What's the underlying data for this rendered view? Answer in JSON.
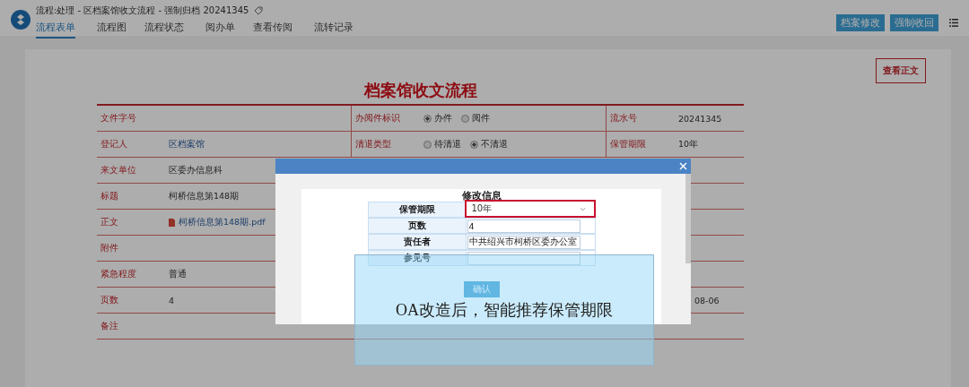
{
  "header": {
    "title": "流程:处理 - 区档案馆收文流程 - 强制归档 20241345",
    "tabs": [
      {
        "label": "流程表单",
        "selected": true
      },
      {
        "label": "流程图",
        "selected": false
      },
      {
        "label": "流程状态",
        "selected": false
      },
      {
        "label": "阅办单",
        "selected": false
      },
      {
        "label": "查看传阅",
        "selected": false
      },
      {
        "label": "流转记录",
        "selected": false
      }
    ],
    "buttons": [
      "档案修改",
      "强制收回"
    ]
  },
  "form": {
    "view_button": "查看正文",
    "title": "档案馆收文流程",
    "rows": [
      {
        "left": {
          "label": "文件字号",
          "kind": "text"
        },
        "middle": {
          "label": "办阅件标识",
          "kind": "radio",
          "options": [
            {
              "label": "办件",
              "selected": true
            },
            {
              "label": "阅件",
              "selected": false
            }
          ]
        },
        "right": {
          "label": "流水号",
          "kind": "text",
          "value": "20241345"
        }
      },
      {
        "left": {
          "label": "登记人",
          "kind": "link",
          "value": "区档案馆"
        },
        "middle": {
          "label": "清退类型",
          "kind": "radio",
          "options": [
            {
              "label": "待清退",
              "selected": false
            },
            {
              "label": "不清退",
              "selected": true
            }
          ]
        },
        "right": {
          "label": "保管期限",
          "kind": "text",
          "value": "10年"
        }
      },
      {
        "left": {
          "label": "来文单位",
          "kind": "text",
          "value": "区委办信息科"
        }
      },
      {
        "left": {
          "label": "标题",
          "kind": "text",
          "value": "柯桥信息第148期"
        }
      },
      {
        "left": {
          "label": "正文",
          "kind": "file",
          "value": "柯桥信息第148期.pdf"
        }
      },
      {
        "left": {
          "label": "附件",
          "kind": "text"
        }
      },
      {
        "left": {
          "label": "紧急程度",
          "kind": "text",
          "value": "普通"
        }
      },
      {
        "left": {
          "label": "页数",
          "kind": "text",
          "value": "4"
        },
        "right": {
          "kind": "text",
          "value": "08-06"
        }
      },
      {
        "left": {
          "label": "备注",
          "kind": "text"
        }
      }
    ]
  },
  "dialog": {
    "title": "修改信息",
    "fields": [
      {
        "label": "保管期限",
        "kind": "select",
        "value": "10年",
        "highlighted": true
      },
      {
        "label": "页数",
        "kind": "input",
        "value": "4"
      },
      {
        "label": "责任者",
        "kind": "input",
        "value": "中共绍兴市柯桥区委办公室"
      },
      {
        "label": "参见号",
        "kind": "input"
      }
    ],
    "confirm": "确认"
  },
  "callout": {
    "text": "OA改造后，智能推荐保管期限"
  }
}
